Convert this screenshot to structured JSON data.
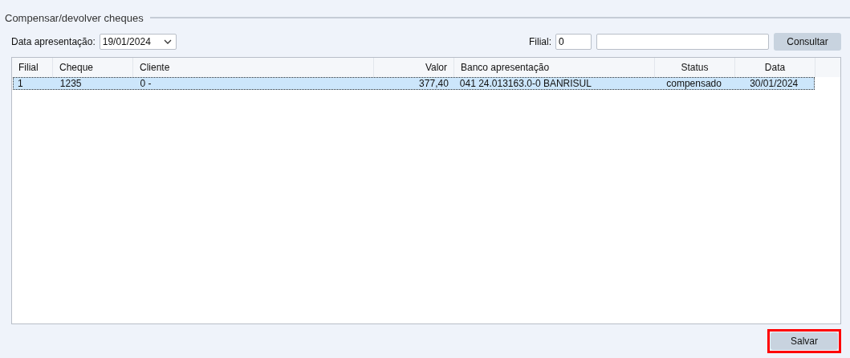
{
  "section": {
    "title": "Compensar/devolver cheques"
  },
  "filters": {
    "date_label": "Data apresentação:",
    "date_value": "19/01/2024",
    "branch_label": "Filial:",
    "branch_value": "0",
    "consult_button": "Consultar"
  },
  "table": {
    "columns": [
      {
        "label": "Filial"
      },
      {
        "label": "Cheque"
      },
      {
        "label": "Cliente"
      },
      {
        "label": "Valor"
      },
      {
        "label": "Banco apresentação"
      },
      {
        "label": "Status"
      },
      {
        "label": "Data"
      }
    ],
    "rows": [
      {
        "cells": [
          "1",
          "1235",
          "0 -",
          "377,40",
          "041 24.013163.0-0 BANRISUL",
          "compensado",
          "30/01/2024"
        ],
        "selected": true
      }
    ]
  },
  "save_button": {
    "label": "Salvar",
    "highlighted": true
  }
}
